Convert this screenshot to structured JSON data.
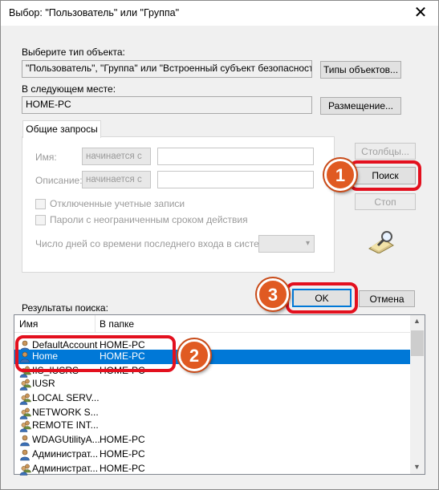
{
  "window": {
    "title": "Выбор: \"Пользователь\" или \"Группа\""
  },
  "object_type": {
    "label": "Выберите тип объекта:",
    "value": "\"Пользователь\", \"Группа\" или \"Встроенный субъект безопасности\"",
    "button": "Типы объектов..."
  },
  "location": {
    "label": "В следующем месте:",
    "value": "HOME-PC",
    "button": "Размещение..."
  },
  "common_queries": {
    "tab": "Общие запросы",
    "name_label": "Имя:",
    "name_operator": "начинается с",
    "desc_label": "Описание:",
    "desc_operator": "начинается с",
    "disabled_accounts": "Отключенные учетные записи",
    "no_expire_passwords": "Пароли с неограниченным сроком действия",
    "days_label": "Число дней со времени последнего входа в систему:"
  },
  "side_buttons": {
    "columns": "Столбцы...",
    "search": "Поиск",
    "stop": "Стоп"
  },
  "footer": {
    "ok": "OK",
    "cancel": "Отмена"
  },
  "results": {
    "label": "Результаты поиска:",
    "headers": {
      "name": "Имя",
      "folder": "В папке"
    },
    "rows": [
      {
        "name": "DefaultAccount",
        "folder": "HOME-PC",
        "type": "user"
      },
      {
        "name": "Home",
        "folder": "HOME-PC",
        "type": "user"
      },
      {
        "name": "IIS_IUSRS",
        "folder": "HOME-PC",
        "type": "group"
      },
      {
        "name": "IUSR",
        "folder": "",
        "type": "group"
      },
      {
        "name": "LOCAL SERV...",
        "folder": "",
        "type": "group"
      },
      {
        "name": "NETWORK S...",
        "folder": "",
        "type": "group"
      },
      {
        "name": "REMOTE INT...",
        "folder": "",
        "type": "group"
      },
      {
        "name": "WDAGUtilityA...",
        "folder": "HOME-PC",
        "type": "user"
      },
      {
        "name": "Администрат...",
        "folder": "HOME-PC",
        "type": "user"
      },
      {
        "name": "Администрат...",
        "folder": "HOME-PC",
        "type": "group"
      }
    ]
  },
  "badges": {
    "one": "1",
    "two": "2",
    "three": "3"
  },
  "colors": {
    "highlight": "#e3101e",
    "badge": "#e05a22",
    "selection": "#0078d7"
  },
  "icons": {
    "close": "close-icon",
    "search_decor": "search-magnifier-icon",
    "user": "user-icon",
    "group": "group-icon"
  }
}
